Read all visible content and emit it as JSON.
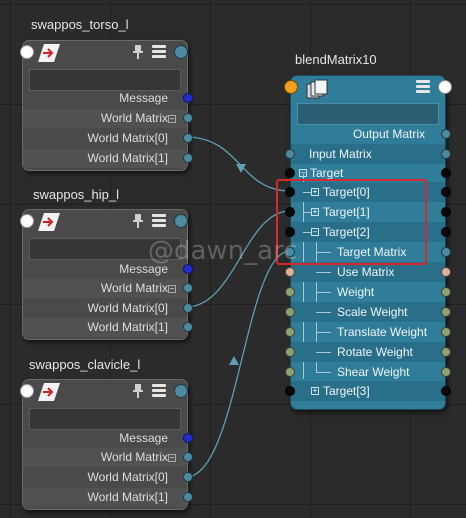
{
  "nodes": [
    {
      "title": "swappos_torso_l",
      "rows": [
        "Message",
        "World Matrix",
        "World Matrix[0]",
        "World Matrix[1]"
      ]
    },
    {
      "title": "swappos_hip_l",
      "rows": [
        "Message",
        "World Matrix",
        "World Matrix[0]",
        "World Matrix[1]"
      ]
    },
    {
      "title": "swappos_clavicle_l",
      "rows": [
        "Message",
        "World Matrix",
        "World Matrix[0]",
        "World Matrix[1]"
      ]
    }
  ],
  "blend_node": {
    "title": "blendMatrix10",
    "output_label": "Output Matrix",
    "input_matrix_label": "Input Matrix",
    "target_label": "Target",
    "targets": [
      "Target[0]",
      "Target[1]",
      "Target[2]"
    ],
    "target_children": [
      "Target Matrix",
      "Use Matrix",
      "Weight",
      "Scale Weight",
      "Translate Weight",
      "Rotate Weight",
      "Shear Weight"
    ],
    "last_target": "Target[3]"
  },
  "watermark": "@dawn_arc",
  "colors": {
    "node_grey": "#4a4a4a",
    "blend_blue": "#2f7d99",
    "highlight_red": "#d8282e",
    "message_plug": "#1f2fd0",
    "matrix_plug": "#4d8aa0",
    "weight_plug": "#8fa070",
    "bool_plug": "#dcb098",
    "wire": "#5e9fb4"
  },
  "icons": [
    "transform-node-icon",
    "pin-icon",
    "attribute-list-icon",
    "blend-matrix-node-icon"
  ]
}
